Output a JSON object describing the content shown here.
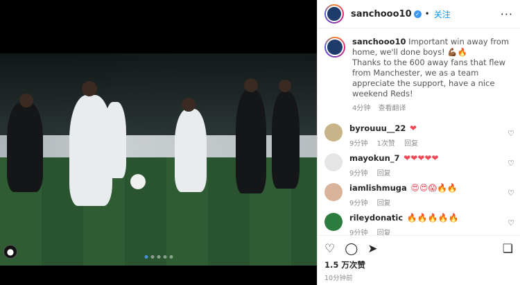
{
  "post": {
    "username": "sanchooo10",
    "follow_label": "关注",
    "more_label": "···",
    "caption_username": "sanchooo10",
    "caption_text": "Important win away from home, we'll done boys! 💪🏾🔥\nThanks to the 600 away fans that flew from Manchester, we as a team appreciate the support, have a nice weekend Reds!",
    "caption_time": "4分钟",
    "see_translation": "查看翻译",
    "likes": "1.5 万次赞",
    "time": "10分钟前"
  },
  "comments": [
    {
      "username": "byrouuu__22",
      "text": "❤",
      "time": "9分钟",
      "likes": "1次赞",
      "reply": "回复",
      "avatar_color": "#c9b48a"
    },
    {
      "username": "mayokun_7",
      "text": "❤❤❤❤❤",
      "time": "9分钟",
      "likes": "",
      "reply": "回复",
      "avatar_color": "#e5e5e5"
    },
    {
      "username": "iamlishmuga",
      "text": "😍😍😱🔥🔥",
      "time": "9分钟",
      "likes": "",
      "reply": "回复",
      "avatar_color": "#d9b39a"
    },
    {
      "username": "rileydonatic",
      "text": "🔥🔥🔥🔥🔥",
      "time": "9分钟",
      "likes": "",
      "reply": "回复",
      "avatar_color": "#2c7b3f"
    }
  ]
}
